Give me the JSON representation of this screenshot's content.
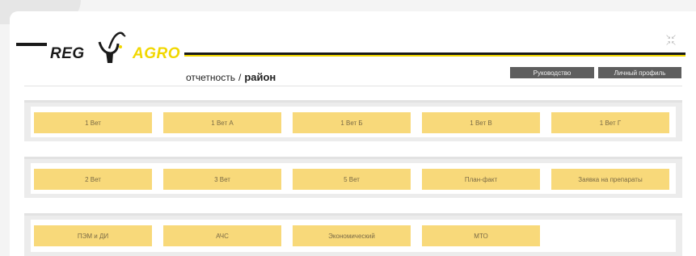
{
  "header": {
    "logo_reg": "REG",
    "logo_agro": "AGRO",
    "breadcrumb_section": "отчетность",
    "breadcrumb_separator": "/",
    "breadcrumb_current": "район",
    "buttons": {
      "guide": "Руководство",
      "profile": "Личный профиль"
    },
    "collapse_icon": "collapse-arrows-icon"
  },
  "groups": [
    {
      "buttons": [
        "1 Вет",
        "1 Вет А",
        "1 Вет Б",
        "1 Вет В",
        "1 Вет Г"
      ]
    },
    {
      "buttons": [
        "2 Вет",
        "3 Вет",
        "5 Вет",
        "План-факт",
        "Заявка на препараты"
      ]
    },
    {
      "buttons": [
        "ПЭМ и ДИ",
        "АЧС",
        "Экономический",
        "МТО"
      ]
    }
  ],
  "colors": {
    "accent_yellow": "#f1d700",
    "button_yellow": "#f8d97a",
    "dark_button": "#5e5e5e"
  }
}
